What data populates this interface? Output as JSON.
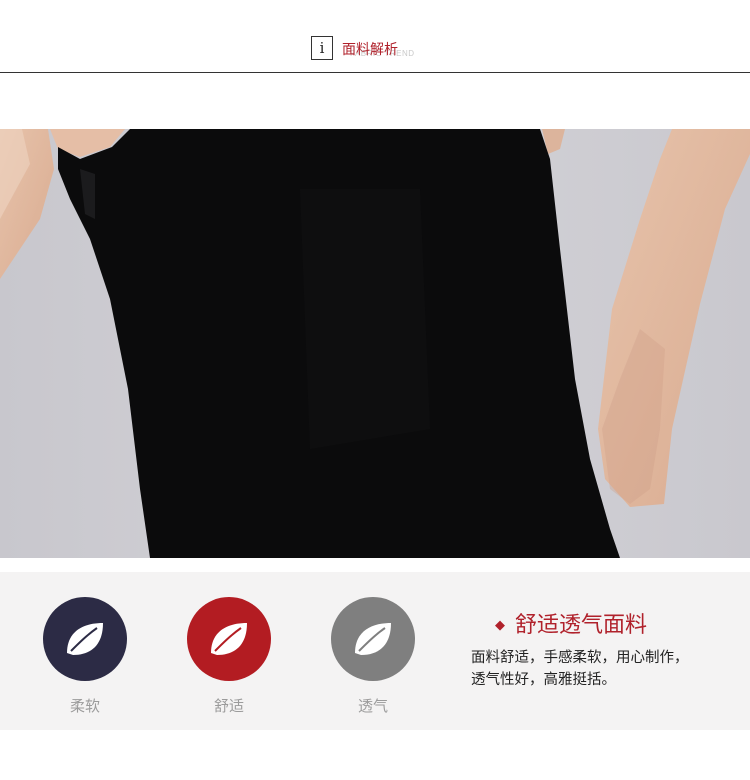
{
  "header": {
    "icon_glyph": "i",
    "title": "面料解析",
    "ghost_text": "FABRIC TREND"
  },
  "photo": {
    "description_icon": "black-sleeveless-top-photo-icon"
  },
  "features": [
    {
      "label": "柔软",
      "color": "#2c2b45",
      "icon": "leaf-icon"
    },
    {
      "label": "舒适",
      "color": "#b31c22",
      "icon": "leaf-icon"
    },
    {
      "label": "透气",
      "color": "#7f7f7f",
      "icon": "leaf-icon"
    }
  ],
  "highlight": {
    "bullet": "◆",
    "heading": "舒适透气面料",
    "line1": "面料舒适，手感柔软，用心制作，",
    "line2": "透气性好，高雅挺括。"
  },
  "colors": {
    "accent": "#b0212b",
    "background": "#f4f3f3"
  }
}
